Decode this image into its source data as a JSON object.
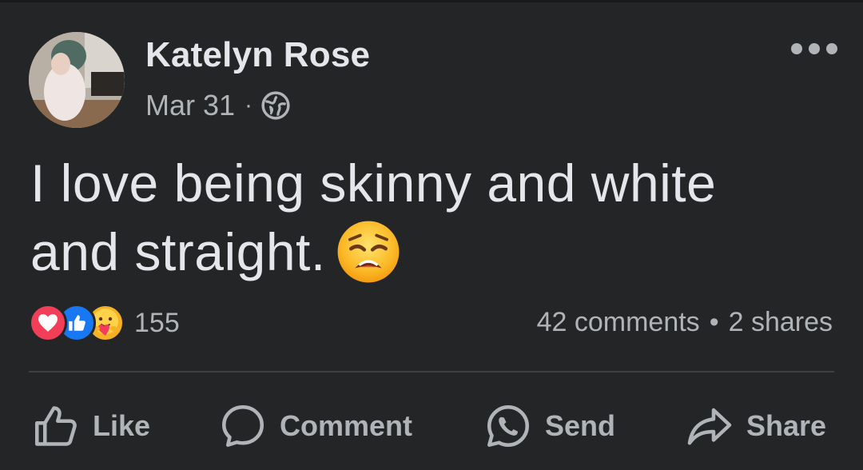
{
  "post": {
    "author": "Katelyn Rose",
    "date": "Mar 31",
    "date_separator": "·",
    "privacy_icon": "globe-icon",
    "text_line1": "I love being skinny and white",
    "text_line2": "and straight.",
    "emoji": "weary-face-emoji"
  },
  "engagement": {
    "reactions": [
      "love",
      "like",
      "care"
    ],
    "reaction_count": "155",
    "comments": "42 comments",
    "separator": "•",
    "shares": "2 shares"
  },
  "actions": {
    "like_label": "Like",
    "comment_label": "Comment",
    "send_label": "Send",
    "share_label": "Share"
  },
  "colors": {
    "background": "#242526",
    "text_primary": "#e4e6eb",
    "text_secondary": "#b0b3b8",
    "love": "#f33e58",
    "like": "#1877f2",
    "care": "#f7b125"
  }
}
